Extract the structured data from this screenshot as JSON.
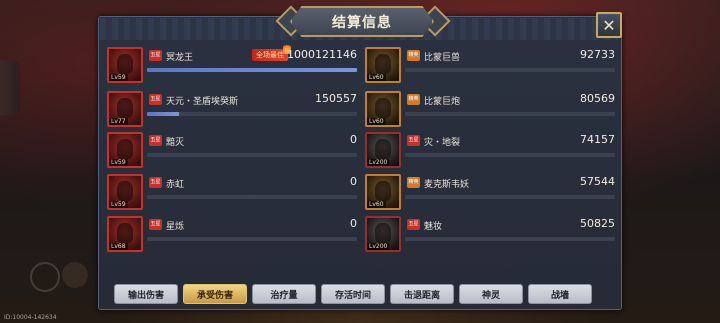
{
  "title": "结算信息",
  "close_icon": "close-x-icon",
  "left_team": [
    {
      "name": "冥龙王",
      "level": "59",
      "value": "1000121146",
      "bar_fraction": 1.0,
      "mvp_tag": "全场最佳",
      "badge": "五星"
    },
    {
      "name": "天元・圣盾埃癸斯",
      "level": "77",
      "value": "150557",
      "bar_fraction": 0.15,
      "badge": "五星"
    },
    {
      "name": "黯灭",
      "level": "59",
      "value": "0",
      "bar_fraction": 0.0,
      "badge": "五星"
    },
    {
      "name": "赤虹",
      "level": "59",
      "value": "0",
      "bar_fraction": 0.0,
      "badge": "五星"
    },
    {
      "name": "星烁",
      "level": "68",
      "value": "0",
      "bar_fraction": 0.0,
      "badge": "五星"
    }
  ],
  "right_team": [
    {
      "name": "比蒙巨兽",
      "level": "60",
      "value": "92733",
      "bar_fraction": 0.0,
      "badge": "精英"
    },
    {
      "name": "比蒙巨炮",
      "level": "60",
      "value": "80569",
      "bar_fraction": 0.0,
      "badge": "精英"
    },
    {
      "name": "灾・地裂",
      "level": "200",
      "value": "74157",
      "bar_fraction": 0.0,
      "badge": "五星"
    },
    {
      "name": "麦克斯韦妖",
      "level": "60",
      "value": "57544",
      "bar_fraction": 0.0,
      "badge": "精英"
    },
    {
      "name": "魅妆",
      "level": "200",
      "value": "50825",
      "bar_fraction": 0.0,
      "badge": "五星"
    }
  ],
  "tabs": [
    "输出伤害",
    "承受伤害",
    "治疗量",
    "存活时间",
    "击退距离",
    "神灵",
    "战墙"
  ],
  "active_tab": "承受伤害",
  "corner_id": "ID:10004-142634",
  "colors": {
    "accent_gold": "#c9a860",
    "bar_blue": "#6a84d2",
    "badge_red": "#c8302a"
  }
}
